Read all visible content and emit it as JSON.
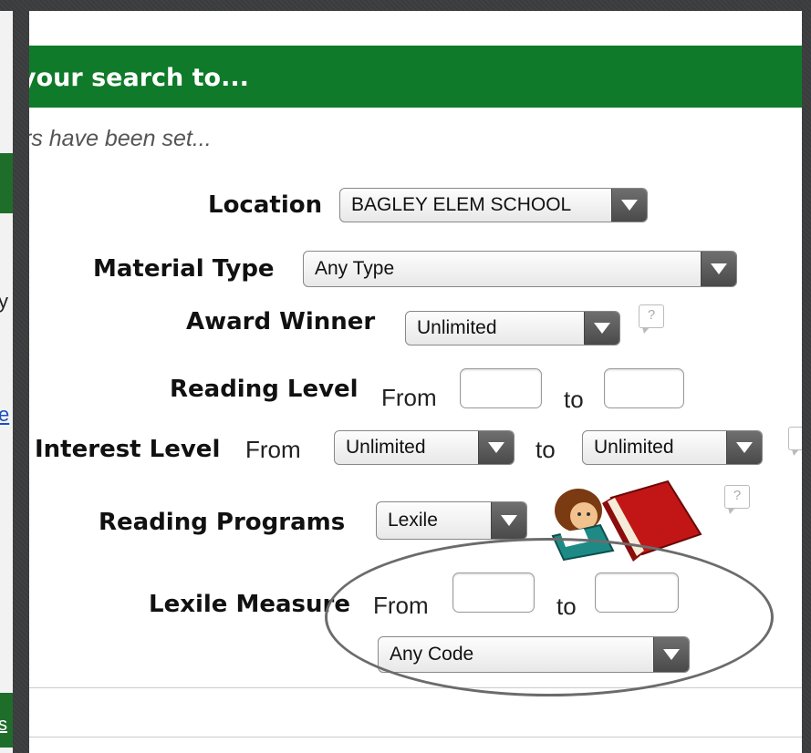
{
  "header": {
    "title": "your search to..."
  },
  "subtitle": "rs have been set...",
  "fields": {
    "location": {
      "label": "Location",
      "value": "BAGLEY ELEM SCHOOL"
    },
    "material_type": {
      "label": "Material Type",
      "value": "Any Type"
    },
    "award_winner": {
      "label": "Award Winner",
      "value": "Unlimited"
    },
    "reading_level": {
      "label": "Reading Level",
      "from": "From",
      "to": "to"
    },
    "interest_level": {
      "label": "Interest Level",
      "from": "From",
      "from_value": "Unlimited",
      "to": "to",
      "to_value": "Unlimited"
    },
    "reading_programs": {
      "label": "Reading Programs",
      "value": "Lexile"
    },
    "lexile_measure": {
      "label": "Lexile Measure",
      "from": "From",
      "to": "to",
      "code_value": "Any Code"
    }
  },
  "help": "?",
  "left_strip": {
    "char1": "y",
    "char2": "e",
    "char3": "s"
  },
  "colors": {
    "header_bg": "#0f7a2a",
    "background": "#3a3b3d"
  }
}
